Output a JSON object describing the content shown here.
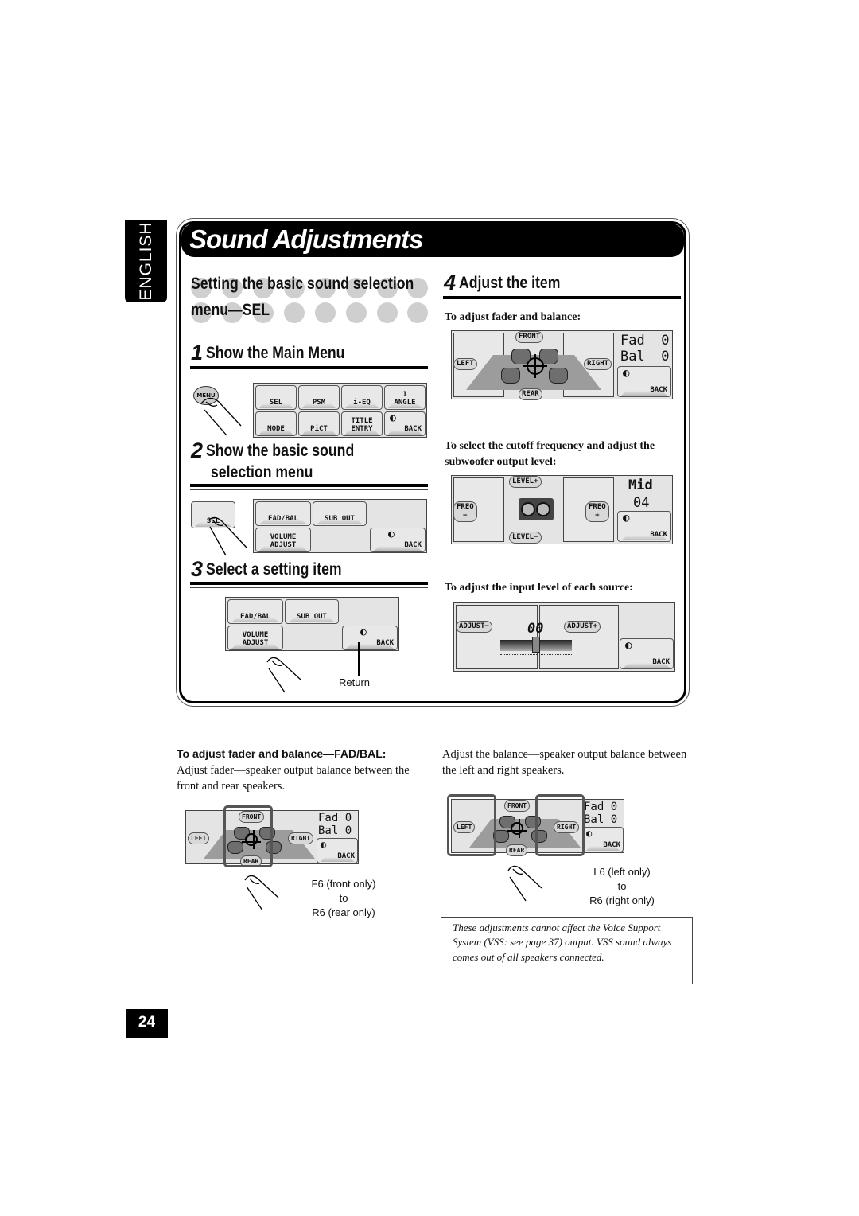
{
  "language_tab": "ENGLISH",
  "page_title": "Sound Adjustments",
  "section": {
    "heading_line1": "Setting the basic sound selection",
    "heading_line2": "menu—SEL"
  },
  "steps": [
    {
      "number": "1",
      "label": "Show the Main Menu"
    },
    {
      "number": "2",
      "label_line1": "Show the basic sound",
      "label_line2": "selection menu"
    },
    {
      "number": "3",
      "label": "Select a setting item"
    },
    {
      "number": "4",
      "label": "Adjust the item"
    }
  ],
  "main_menu": {
    "menu_key": "MENU",
    "buttons": [
      {
        "label": "SEL"
      },
      {
        "label": "PSM"
      },
      {
        "label": "i-EQ"
      },
      {
        "label": "1\nANGLE"
      },
      {
        "label": "MODE"
      },
      {
        "label": "PiCT"
      },
      {
        "label": "TITLE\nENTRY"
      },
      {
        "label": "BACK"
      }
    ]
  },
  "sel_menu": {
    "sel_key": "SEL",
    "buttons": [
      {
        "label": "FAD/BAL"
      },
      {
        "label": "SUB OUT"
      },
      {
        "label": "VOLUME\nADJUST"
      },
      {
        "label": "BACK"
      }
    ],
    "return_label": "Return"
  },
  "adjust": {
    "fader_caption": "To adjust fader and balance:",
    "fader_screen": {
      "front": "FRONT",
      "rear": "REAR",
      "left": "LEFT",
      "right": "RIGHT",
      "fad_label": "Fad",
      "fad_value": "0",
      "bal_label": "Bal",
      "bal_value": "0",
      "back": "BACK"
    },
    "sub_caption": "To select the cutoff frequency and adjust the subwoofer output level:",
    "sub_screen": {
      "level_plus": "LEVEL+",
      "level_minus": "LEVEL−",
      "freq_minus": "FREQ\n−",
      "freq_plus": "FREQ\n+",
      "freq_value": "Mid",
      "level_value": "04",
      "back": "BACK"
    },
    "vol_caption": "To adjust the input level of each source:",
    "vol_screen": {
      "adjust_minus": "ADJUST−",
      "adjust_plus": "ADJUST+",
      "value": "00",
      "back": "BACK",
      "slider_fraction": 0.5
    }
  },
  "fadbal": {
    "heading": "To adjust fader and balance—FAD/BAL:",
    "fader_text": "Adjust fader—speaker output balance between the front and rear speakers.",
    "fader_range": [
      "F6 (front only)",
      "to",
      "R6 (rear only)"
    ],
    "balance_text": "Adjust the balance—speaker output balance between the left and right speakers.",
    "balance_range": [
      "L6 (left only)",
      "to",
      "R6 (right only)"
    ]
  },
  "note": "These adjustments cannot affect the Voice Support System (VSS: see page 37) output. VSS sound always comes out of all speakers connected.",
  "page_number": "24"
}
